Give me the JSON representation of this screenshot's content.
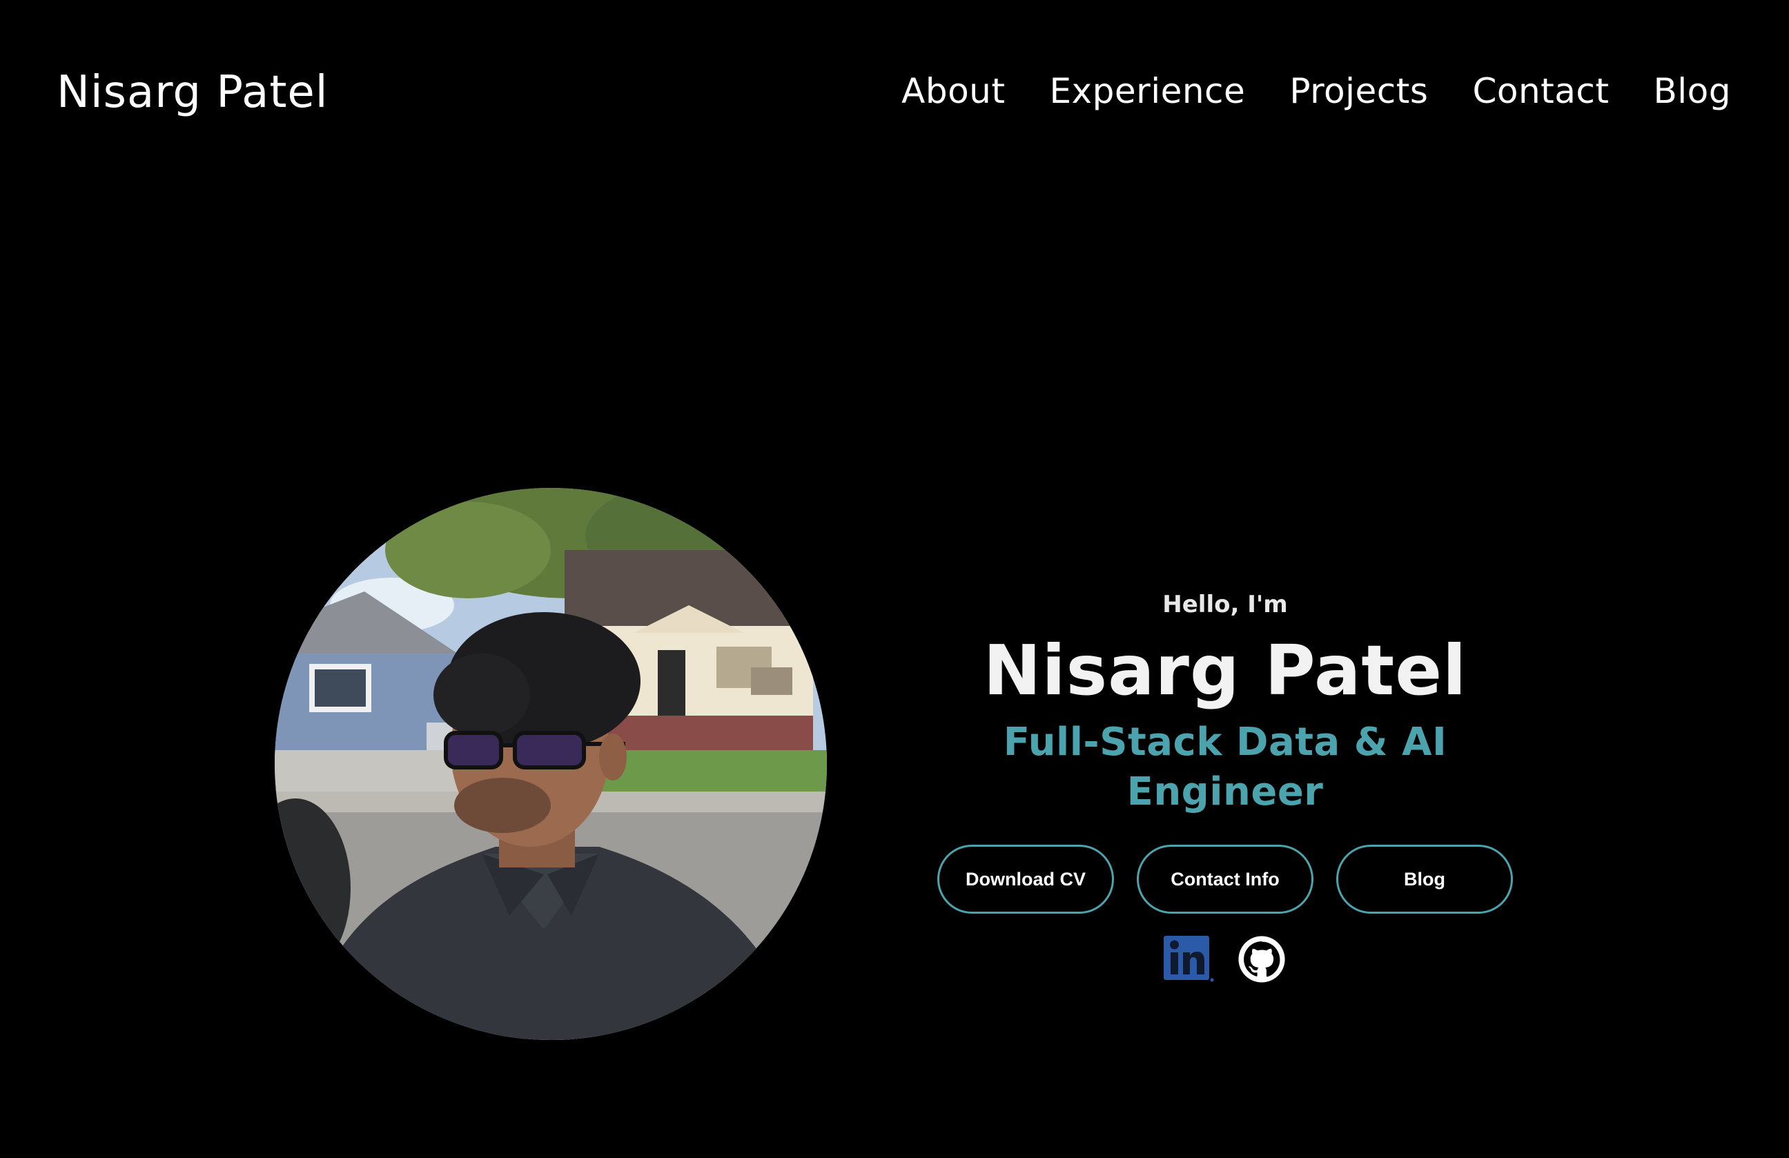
{
  "nav": {
    "logo": "Nisarg Patel",
    "links": [
      "About",
      "Experience",
      "Projects",
      "Contact",
      "Blog"
    ]
  },
  "hero": {
    "greeting": "Hello, I'm",
    "name": "Nisarg Patel",
    "title": "Full-Stack Data & AI Engineer",
    "buttons": [
      "Download CV",
      "Contact Info",
      "Blog"
    ],
    "socials": [
      {
        "icon": "linkedin-icon",
        "label": "LinkedIn"
      },
      {
        "icon": "github-icon",
        "label": "GitHub"
      }
    ]
  },
  "colors": {
    "background": "#000000",
    "accent": "#4ba3ad",
    "text": "#ffffff",
    "linkedin": "#2a5aa8"
  }
}
